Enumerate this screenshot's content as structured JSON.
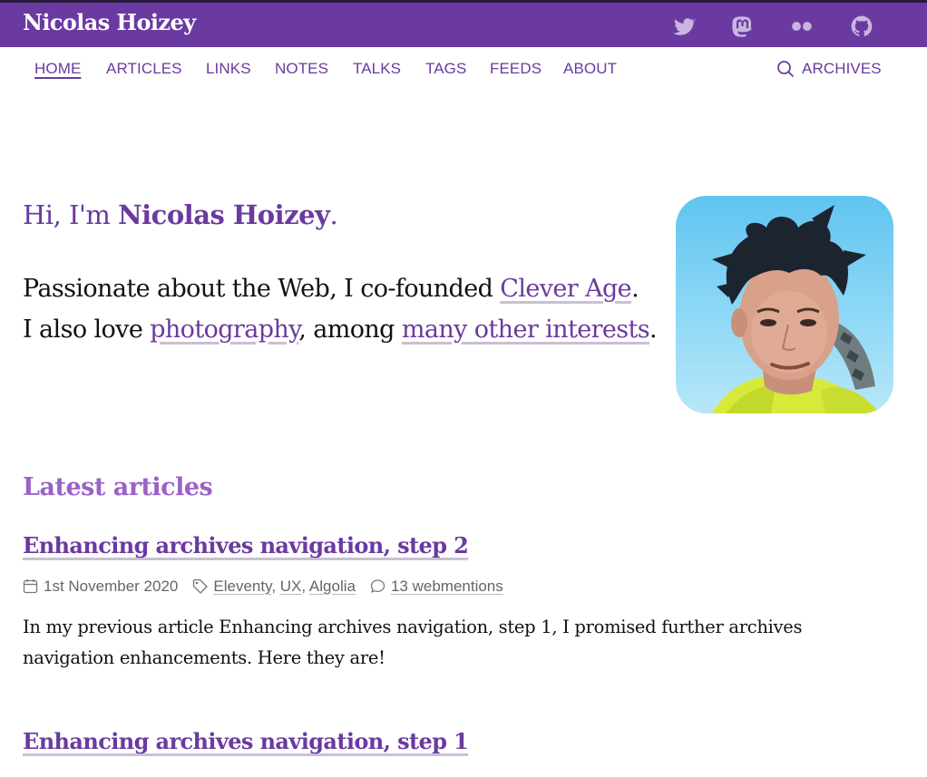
{
  "header": {
    "site_title": "Nicolas Hoizey",
    "social": [
      {
        "icon": "twitter-icon"
      },
      {
        "icon": "mastodon-icon"
      },
      {
        "icon": "flickr-icon"
      },
      {
        "icon": "github-icon"
      }
    ]
  },
  "nav": {
    "items": [
      {
        "label": "HOME",
        "active": true
      },
      {
        "label": "ARTICLES"
      },
      {
        "label": "LINKS"
      },
      {
        "label": "NOTES"
      },
      {
        "label": "TALKS"
      },
      {
        "label": "TAGS"
      },
      {
        "label": "FEEDS"
      },
      {
        "label": "ABOUT"
      }
    ],
    "archives_label": "ARCHIVES"
  },
  "intro": {
    "greeting_prefix": "Hi, I'm ",
    "greeting_name": "Nicolas Hoizey",
    "greeting_suffix": ".",
    "line1_prefix": "Passionate about the Web, I co-founded ",
    "line1_link": "Clever Age",
    "line1_suffix": ".",
    "line2_prefix": "I also love ",
    "line2_link1": "photography",
    "line2_mid": ", among ",
    "line2_link2": "many other interests",
    "line2_suffix": "."
  },
  "latest": {
    "title": "Latest articles",
    "articles": [
      {
        "title": "Enhancing archives navigation, step 2",
        "date": "1st November 2020",
        "tags": [
          "Eleventy",
          "UX",
          "Algolia"
        ],
        "webmentions": "13 webmentions",
        "excerpt": "In my previous article Enhancing archives navigation, step 1, I promised further archives navigation enhancements. Here they are!"
      },
      {
        "title": "Enhancing archives navigation, step 1"
      }
    ]
  },
  "colors": {
    "brand": "#6a3aa0",
    "section_title": "#9a62c6",
    "meta_text": "#666666"
  }
}
